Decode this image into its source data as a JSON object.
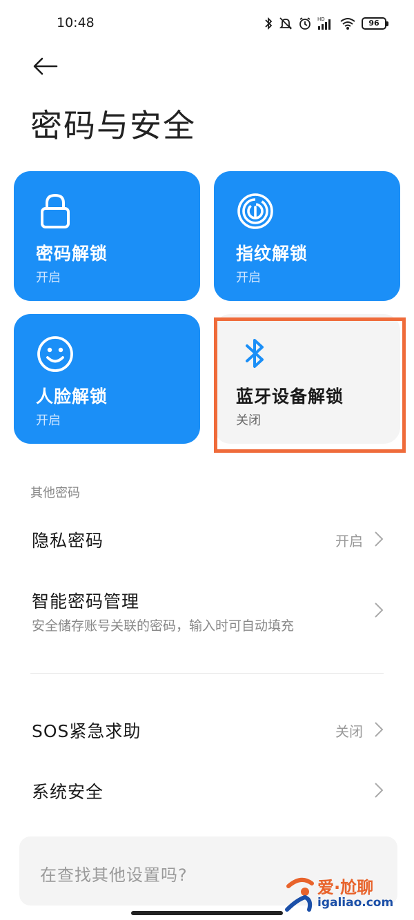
{
  "status_bar": {
    "time": "10:48",
    "battery": "96",
    "icons": [
      "bluetooth-icon",
      "mute-bell-icon",
      "alarm-icon",
      "hd-signal-icon",
      "wifi-icon",
      "battery-icon"
    ]
  },
  "header": {
    "back_icon": "back-arrow-icon",
    "title": "密码与安全"
  },
  "unlock_cards": [
    {
      "icon": "lock-icon",
      "title": "密码解锁",
      "status": "开启",
      "enabled": true
    },
    {
      "icon": "fingerprint-icon",
      "title": "指纹解锁",
      "status": "开启",
      "enabled": true
    },
    {
      "icon": "face-icon",
      "title": "人脸解锁",
      "status": "开启",
      "enabled": true
    },
    {
      "icon": "bluetooth-icon",
      "title": "蓝牙设备解锁",
      "status": "关闭",
      "enabled": false
    }
  ],
  "other_section": {
    "header": "其他密码",
    "rows": [
      {
        "title": "隐私密码",
        "value": "开启"
      },
      {
        "title": "智能密码管理",
        "subtitle": "安全储存账号关联的密码，输入时可自动填充"
      }
    ]
  },
  "more_rows": [
    {
      "title": "SOS紧急求助",
      "value": "关闭"
    },
    {
      "title": "系统安全"
    }
  ],
  "search": {
    "placeholder": "在查找其他设置吗?"
  },
  "watermark": {
    "name": "爱·尬聊",
    "url": "igaliao.com"
  },
  "colors": {
    "card_blue": "#1b8ff7",
    "card_off": "#f4f4f4",
    "highlight": "#ef6b3a"
  }
}
